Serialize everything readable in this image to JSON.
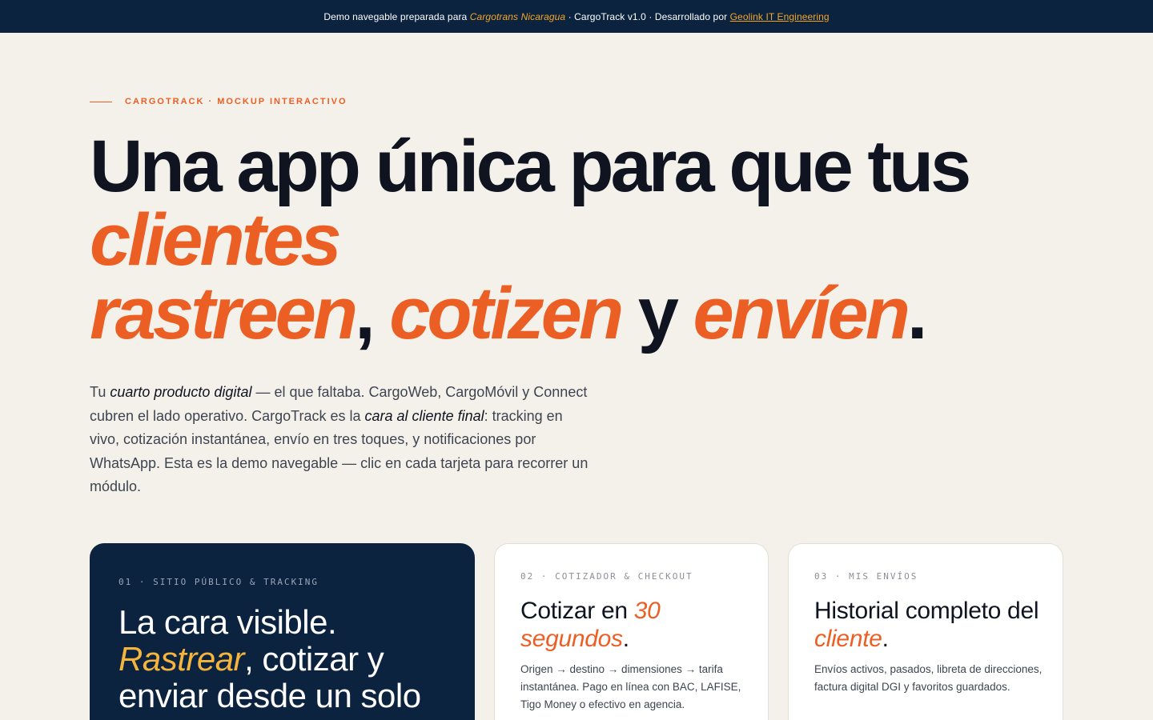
{
  "topbar": {
    "prefix": "Demo navegable preparada para",
    "client": "Cargotrans Nicaragua",
    "middle": "· CargoTrack v1.0 · Desarrollado por",
    "developer": "Geolink IT Engineering"
  },
  "eyebrow": "CARGOTRACK · MOCKUP INTERACTIVO",
  "headline": {
    "line1": "Una app única para que tus",
    "line2_accent": "clientes",
    "line3_a": "rastreen",
    "line3_b": ", ",
    "line3_c": "cotizen",
    "line3_d": " y ",
    "line3_e": "envíen",
    "line3_f": "."
  },
  "lede": {
    "t1": "Tu ",
    "em1": "cuarto producto digital",
    "t2": " — el que faltaba. CargoWeb, CargoMóvil y Connect cubren el lado operativo. CargoTrack es la ",
    "em2": "cara al cliente final",
    "t3": ": tracking en vivo, cotización instantánea, envío en tres toques, y notificaciones por WhatsApp. Esta es la demo navegable — clic en cada tarjeta para recorrer un módulo."
  },
  "cards": [
    {
      "tag": "01 · SITIO PÚBLICO & TRACKING",
      "title_a": "La cara visible. ",
      "title_accent": "Rastrear",
      "title_b": ", cotizar y enviar desde un solo"
    },
    {
      "tag": "02 · COTIZADOR & CHECKOUT",
      "title_a": "Cotizar en ",
      "title_accent": "30 segundos",
      "title_b": ".",
      "body": "Origen → destino → dimensiones → tarifa instantánea. Pago en línea con BAC, LAFISE, Tigo Money o efectivo en agencia."
    },
    {
      "tag": "03 · MIS ENVÍOS",
      "title_a": "Historial completo del ",
      "title_accent": "cliente",
      "title_b": ".",
      "body": "Envíos activos, pasados, libreta de direcciones, factura digital DGI y favoritos guardados."
    }
  ],
  "colors": {
    "navy": "#0c2340",
    "accent_orange": "#ec5f24",
    "accent_gold": "#f5a623",
    "background": "#f4f1eb"
  }
}
